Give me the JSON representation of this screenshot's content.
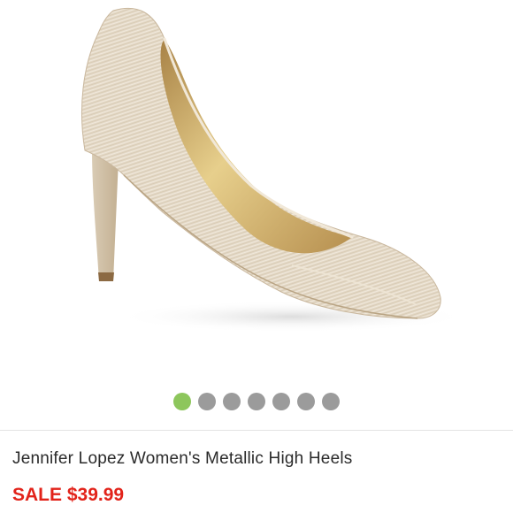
{
  "product": {
    "title": "Jennifer Lopez Women's Metallic High Heels",
    "price_label": "SALE $39.99"
  },
  "gallery": {
    "image": "metallic-pointed-toe-pump-photo",
    "slide_count": 7,
    "active_slide": 1
  },
  "colors": {
    "sale": "#e2231a",
    "active_dot": "#8dc65c",
    "inactive_dot": "#9b9b9b",
    "shoe": "#e3d7c4"
  }
}
